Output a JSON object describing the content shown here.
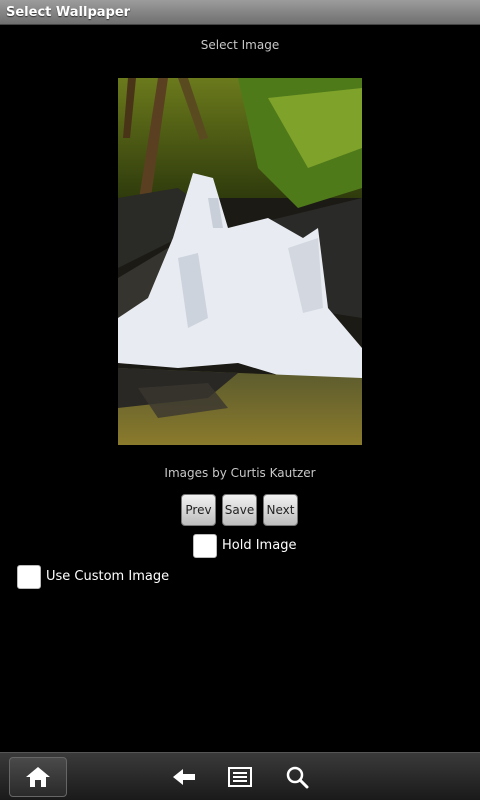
{
  "window": {
    "title": "Select Wallpaper"
  },
  "main": {
    "heading": "Select Image",
    "credit": "Images by Curtis Kautzer",
    "buttons": {
      "prev": "Prev",
      "save": "Save",
      "next": "Next"
    },
    "hold_image": {
      "label": "Hold Image",
      "checked": false
    },
    "use_custom_image": {
      "label": "Use Custom Image",
      "checked": false
    }
  },
  "system_bar": {
    "icons": [
      "home-icon",
      "back-icon",
      "menu-icon",
      "search-icon"
    ]
  }
}
